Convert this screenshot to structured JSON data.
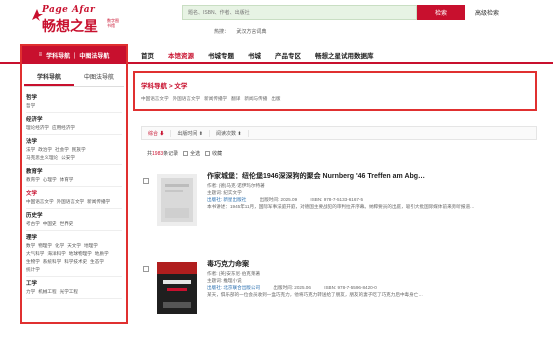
{
  "header": {
    "logo": {
      "top": "Page Afar",
      "main": "畅想之星",
      "sub": "数字图书馆"
    },
    "search_placeholder": "题名、ISBN、作者、出版社",
    "search_button": "检索",
    "advanced": "高级检索",
    "hot_label": "热搜：",
    "hot_terms": [
      "武汉方言词典"
    ]
  },
  "nav": {
    "category_label": "学科导航 ｜ 中图法导航",
    "links": [
      "首页",
      "本馆资源",
      "书城专题",
      "书城",
      "产品专区",
      "畅想之星试用数据库"
    ]
  },
  "sidebar": {
    "tabs": [
      "学科导航",
      "中图法导航"
    ],
    "categories": [
      {
        "name": "哲学",
        "subs": [
          "哲学"
        ]
      },
      {
        "name": "经济学",
        "subs": [
          "理论经济学",
          "应用经济学"
        ]
      },
      {
        "name": "法学",
        "subs": [
          "法学",
          "政治学",
          "社会学",
          "民族学",
          "马克思主义理论",
          "公安学"
        ]
      },
      {
        "name": "教育学",
        "subs": [
          "教育学",
          "心理学",
          "体育学"
        ]
      },
      {
        "name": "文学",
        "subs": [
          "中国语言文学",
          "外国语言文学",
          "新闻传播学"
        ]
      },
      {
        "name": "历史学",
        "subs": [
          "考古学",
          "中国史",
          "世界史"
        ]
      },
      {
        "name": "理学",
        "subs": [
          "数学",
          "物理学",
          "化学",
          "天文学",
          "地理学",
          "大气科学",
          "海洋科学",
          "地球物理学",
          "地质学",
          "生物学",
          "系统科学",
          "科学技术史",
          "生态学",
          "统计学"
        ]
      },
      {
        "name": "工学",
        "subs": [
          "力学",
          "机械工程",
          "光学工程"
        ]
      }
    ]
  },
  "breadcrumb": {
    "root": "学科导航",
    "sep": ">",
    "current": "文学"
  },
  "crumb_subs": [
    "中国语言文学",
    "外国语言文学",
    "新闻传播学",
    "翻译",
    "新闻与传播",
    "出版"
  ],
  "sort": {
    "items": [
      "综合 ⬇",
      "出版时间 ⬍",
      "阅读次数 ⬍"
    ]
  },
  "results": {
    "prefix": "共",
    "count": "1983",
    "suffix": "条记录",
    "select_all": "全选",
    "batch": "收藏"
  },
  "books": [
    {
      "title": "作家城堡：纽伦堡1946深深狗的聚会 Nurnberg '46 Treffen am Abg…",
      "author": "作者: (德)马克·诺伊玛尔特著",
      "publisher_label": "主题词: 纪实文学",
      "press": "出版社: 新星出版社",
      "date": "出版时间: 2025.09",
      "isbn": "ISBN: 978-7-5133-6167-5",
      "abstract": "本书讲述：1945年11月，国际军事法庭开庭，对德国主要战犯的审判拉开序幕。纳粹要员的出庭，吸引大批国际媒体前来旁听报道…"
    },
    {
      "title": "毒巧克力命案",
      "author": "作者: (英)安东尼·伯克莱著",
      "publisher_label": "主题词: 推理小说",
      "press": "出版社: 北京联合出版公司",
      "date": "出版时间: 2025.06",
      "isbn": "ISBN: 978-7-5596-8420-0",
      "abstract": "某天，俱乐部的一位会员收到一盒巧克力，他将巧克力转送给了朋友，朋友的妻子吃了巧克力后中毒身亡…"
    }
  ],
  "colors": {
    "brand": "#c8102e",
    "highlight": "#e03030"
  }
}
